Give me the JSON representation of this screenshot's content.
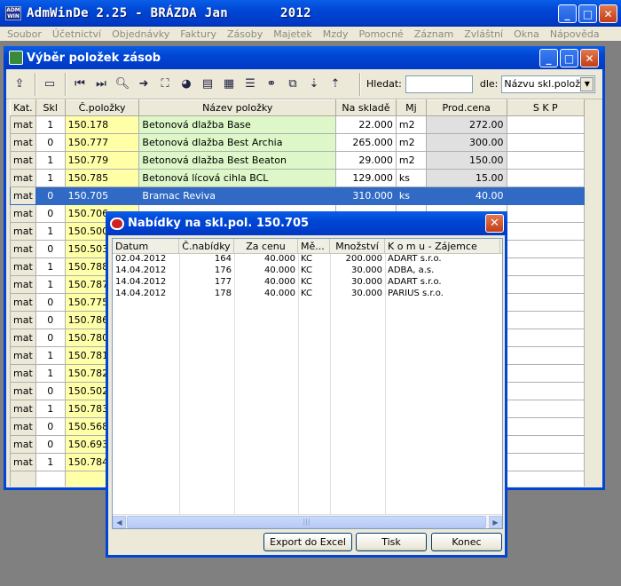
{
  "app": {
    "title": "AdmWinDe 2.25 - BRÁZDA Jan",
    "year": "2012",
    "icon_text": "ADM WIN"
  },
  "menu": [
    "Soubor",
    "Účetnictví",
    "Objednávky",
    "Faktury",
    "Zásoby",
    "Majetek",
    "Mzdy",
    "Pomocné",
    "Záznam",
    "Zvláštní",
    "Okna",
    "Nápověda"
  ],
  "child": {
    "title": "Výběr položek zásob",
    "search": {
      "label": "Hledat:",
      "value": "",
      "by_label": "dle:",
      "by_value": "Názvu skl.položky"
    },
    "toolbar_icons": [
      "add-item-icon",
      "open-folder-icon",
      "first-record-icon",
      "last-record-icon",
      "find-icon",
      "next-arrow-icon",
      "select-frame-icon",
      "chart-icon",
      "report-icon",
      "table-icon",
      "list-icon",
      "binoculars-icon",
      "copy-icon",
      "sort-asc-icon",
      "sort-desc-icon"
    ],
    "columns": [
      "Kat.",
      "Skl",
      "Č.položky",
      "Název položky",
      "Na skladě",
      "Mj",
      "Prod.cena",
      "S K P"
    ],
    "rows": [
      {
        "kat": "mat",
        "skl": "1",
        "cp": "150.178",
        "nazev": "Betonová dlažba Base",
        "sklad": "22.000",
        "mj": "m2",
        "cena": "272.00"
      },
      {
        "kat": "mat",
        "skl": "0",
        "cp": "150.777",
        "nazev": "Betonová dlažba Best Archia",
        "sklad": "265.000",
        "mj": "m2",
        "cena": "300.00"
      },
      {
        "kat": "mat",
        "skl": "1",
        "cp": "150.779",
        "nazev": "Betonová dlažba Best Beaton",
        "sklad": "29.000",
        "mj": "m2",
        "cena": "150.00"
      },
      {
        "kat": "mat",
        "skl": "1",
        "cp": "150.785",
        "nazev": "Betonová lícová cihla BCL",
        "sklad": "129.000",
        "mj": "ks",
        "cena": "15.00"
      },
      {
        "kat": "mat",
        "skl": "0",
        "cp": "150.705",
        "nazev": "Bramac Reviva",
        "sklad": "310.000",
        "mj": "ks",
        "cena": "40.00",
        "selected": true
      },
      {
        "kat": "mat",
        "skl": "0",
        "cp": "150.706"
      },
      {
        "kat": "mat",
        "skl": "1",
        "cp": "150.500"
      },
      {
        "kat": "mat",
        "skl": "0",
        "cp": "150.503"
      },
      {
        "kat": "mat",
        "skl": "1",
        "cp": "150.788"
      },
      {
        "kat": "mat",
        "skl": "1",
        "cp": "150.787"
      },
      {
        "kat": "mat",
        "skl": "0",
        "cp": "150.775"
      },
      {
        "kat": "mat",
        "skl": "0",
        "cp": "150.786"
      },
      {
        "kat": "mat",
        "skl": "0",
        "cp": "150.780"
      },
      {
        "kat": "mat",
        "skl": "1",
        "cp": "150.781"
      },
      {
        "kat": "mat",
        "skl": "1",
        "cp": "150.782"
      },
      {
        "kat": "mat",
        "skl": "0",
        "cp": "150.502"
      },
      {
        "kat": "mat",
        "skl": "1",
        "cp": "150.783"
      },
      {
        "kat": "mat",
        "skl": "0",
        "cp": "150.568"
      },
      {
        "kat": "mat",
        "skl": "0",
        "cp": "150.693"
      },
      {
        "kat": "mat",
        "skl": "1",
        "cp": "150.784"
      }
    ]
  },
  "dialog": {
    "title": "Nabídky na skl.pol. 150.705",
    "columns": [
      "Datum",
      "Č.nabídky",
      "Za cenu",
      "Mě...",
      "Množství",
      "K o m u  - Zájemce"
    ],
    "rows": [
      [
        "02.04.2012",
        "164",
        "40.000",
        "KČ",
        "200.000",
        "ADART s.r.o."
      ],
      [
        "14.04.2012",
        "176",
        "40.000",
        "KČ",
        "30.000",
        "ADBA, a.s."
      ],
      [
        "14.04.2012",
        "177",
        "40.000",
        "KČ",
        "30.000",
        "ADART s.r.o."
      ],
      [
        "14.04.2012",
        "178",
        "40.000",
        "KČ",
        "30.000",
        "PARIUS s.r.o."
      ]
    ],
    "buttons": {
      "export": "Export do Excel",
      "print": "Tisk",
      "close": "Konec"
    }
  }
}
